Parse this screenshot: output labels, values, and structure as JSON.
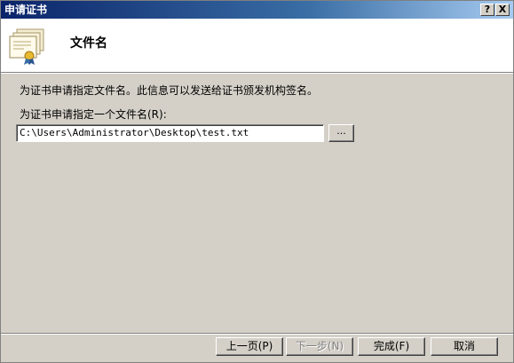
{
  "window": {
    "title": "申请证书",
    "help_label": "?",
    "close_label": "X"
  },
  "header": {
    "icon": "certificate-icon",
    "title": "文件名"
  },
  "main": {
    "description": "为证书申请指定文件名。此信息可以发送给证书颁发机构签名。",
    "field_label": "为证书申请指定一个文件名(R):",
    "file_path": "C:\\Users\\Administrator\\Desktop\\test.txt",
    "browse_label": "..."
  },
  "footer": {
    "back_label": "上一页(P)",
    "next_label": "下一步(N)",
    "finish_label": "完成(F)",
    "cancel_label": "取消"
  }
}
